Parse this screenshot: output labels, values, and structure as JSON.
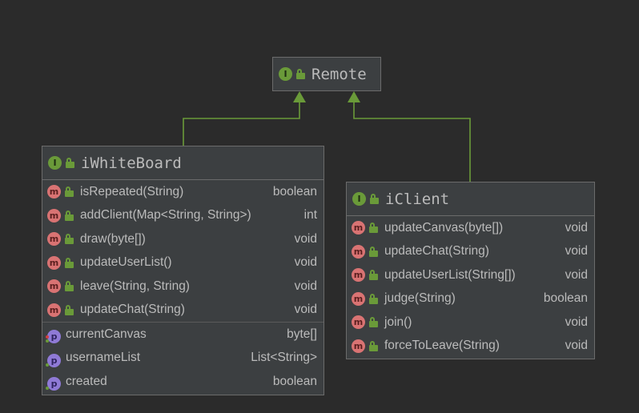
{
  "diagram": {
    "colors": {
      "background": "#2b2b2b",
      "box": "#3c3f41",
      "edge": "#6a9a39",
      "interface_icon": "#6a9a39",
      "method_icon": "#d97373",
      "property_icon": "#8f7ad6",
      "text": "#bbbbbb"
    },
    "icons": {
      "interface": "I",
      "method": "m",
      "property": "p"
    },
    "nodes": {
      "remote": {
        "title": "Remote"
      },
      "iwhiteboard": {
        "title": "iWhiteBoard",
        "methods": [
          {
            "name": "isRepeated(String)",
            "type": "boolean"
          },
          {
            "name": "addClient(Map<String, String>)",
            "type": "int"
          },
          {
            "name": "draw(byte[])",
            "type": "void"
          },
          {
            "name": "updateUserList()",
            "type": "void"
          },
          {
            "name": "leave(String, String)",
            "type": "void"
          },
          {
            "name": "updateChat(String)",
            "type": "void"
          }
        ],
        "properties": [
          {
            "name": "currentCanvas",
            "type": "byte[]"
          },
          {
            "name": "usernameList",
            "type": "List<String>"
          },
          {
            "name": "created",
            "type": "boolean"
          }
        ]
      },
      "iclient": {
        "title": "iClient",
        "methods": [
          {
            "name": "updateCanvas(byte[])",
            "type": "void"
          },
          {
            "name": "updateChat(String)",
            "type": "void"
          },
          {
            "name": "updateUserList(String[])",
            "type": "void"
          },
          {
            "name": "judge(String)",
            "type": "boolean"
          },
          {
            "name": "join()",
            "type": "void"
          },
          {
            "name": "forceToLeave(String)",
            "type": "void"
          }
        ]
      }
    },
    "edges": [
      {
        "from": "iwhiteboard",
        "to": "remote",
        "kind": "extends"
      },
      {
        "from": "iclient",
        "to": "remote",
        "kind": "extends"
      }
    ]
  }
}
